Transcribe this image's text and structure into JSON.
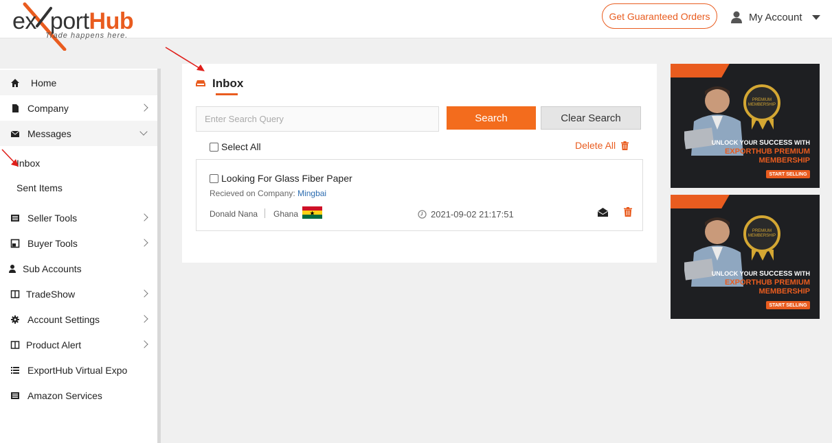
{
  "header": {
    "logo": {
      "word_left": "ex",
      "word_mid": "port",
      "word_right": "Hub",
      "tagline": "Trade happens here."
    },
    "cta_label": "Get Guaranteed Orders",
    "account_label": "My Account"
  },
  "sidebar": {
    "items": [
      {
        "label": "Home",
        "icon": "home-icon"
      },
      {
        "label": "Company",
        "icon": "file-icon"
      },
      {
        "label": "Messages",
        "icon": "envelope-icon"
      },
      {
        "label": "Inbox"
      },
      {
        "label": "Sent Items"
      },
      {
        "label": "Seller Tools",
        "icon": "list-icon"
      },
      {
        "label": "Buyer Tools",
        "icon": "image-icon"
      },
      {
        "label": "Sub Accounts",
        "icon": "user-icon"
      },
      {
        "label": "TradeShow",
        "icon": "columns-icon"
      },
      {
        "label": "Account Settings",
        "icon": "gear-icon"
      },
      {
        "label": "Product Alert",
        "icon": "columns-icon"
      },
      {
        "label": "ExportHub Virtual Expo",
        "icon": "list-icon"
      },
      {
        "label": "Amazon Services",
        "icon": "list-icon"
      }
    ]
  },
  "inbox": {
    "title": "Inbox",
    "search_placeholder": "Enter Search Query",
    "search_label": "Search",
    "clear_label": "Clear Search",
    "select_all_label": "Select All",
    "delete_all_label": "Delete All",
    "messages": [
      {
        "subject": "Looking For Glass Fiber Paper",
        "received_prefix": "Recieved on Company:",
        "company": "Mingbai",
        "sender": "Donald Nana",
        "country": "Ghana",
        "datetime": "2021-09-02 21:17:51"
      }
    ]
  },
  "ads": [
    {
      "line1_pre": "UNLOCK YOUR",
      "line1_bold": "SUCCESS",
      "line1_post": "WITH",
      "line2a": "EXPORTHUB PREMIUM",
      "line2b": "MEMBERSHIP",
      "cta": "START SELLING",
      "badge": "PREMIUM MEMBERSHIP"
    },
    {
      "line1_pre": "UNLOCK YOUR",
      "line1_bold": "SUCCESS",
      "line1_post": "WITH",
      "line2a": "EXPORTHUB PREMIUM",
      "line2b": "MEMBERSHIP",
      "cta": "START SELLING",
      "badge": "PREMIUM MEMBERSHIP"
    }
  ],
  "colors": {
    "accent": "#e95c1f",
    "link": "#2b6cb0",
    "annotation": "#e0201b"
  }
}
